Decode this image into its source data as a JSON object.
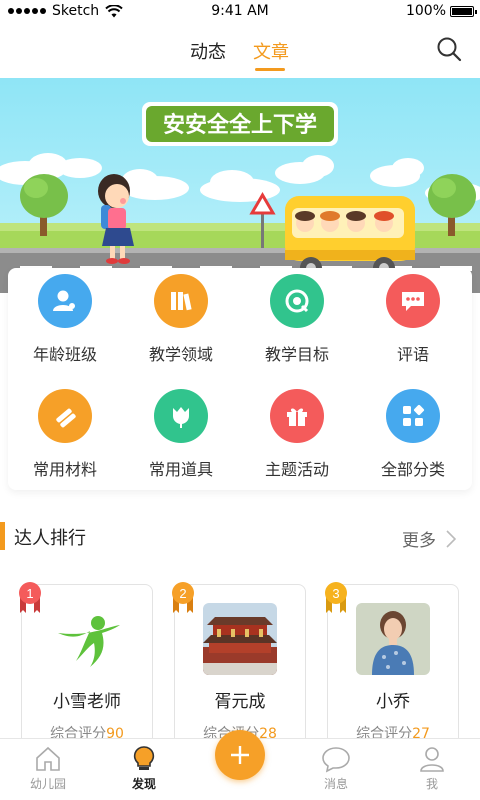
{
  "status_bar": {
    "carrier": "Sketch",
    "time": "9:41 AM",
    "battery": "100%"
  },
  "header": {
    "tabs": [
      {
        "label": "动态"
      },
      {
        "label": "文章"
      }
    ],
    "active_tab": "文章"
  },
  "banner": {
    "title": "安安全全上下学"
  },
  "categories": [
    {
      "label": "年龄班级",
      "icon": "person-icon",
      "color": "#46a9ee"
    },
    {
      "label": "教学领域",
      "icon": "books-icon",
      "color": "#f6a028"
    },
    {
      "label": "教学目标",
      "icon": "target-icon",
      "color": "#31c48d"
    },
    {
      "label": "评语",
      "icon": "comment-icon",
      "color": "#f45b5b"
    },
    {
      "label": "常用材料",
      "icon": "pencil-icon",
      "color": "#f6a028"
    },
    {
      "label": "常用道具",
      "icon": "tulip-icon",
      "color": "#31c48d"
    },
    {
      "label": "主题活动",
      "icon": "gift-icon",
      "color": "#f45b5b"
    },
    {
      "label": "全部分类",
      "icon": "grid-icon",
      "color": "#46a9ee"
    }
  ],
  "ranking": {
    "title": "达人排行",
    "more": "更多",
    "items": [
      {
        "rank": "1",
        "name": "小雪老师",
        "score_label": "综合评分",
        "score": "90",
        "avatar": "green-figure-logo",
        "badge_color": "#f45b5b"
      },
      {
        "rank": "2",
        "name": "胥元成",
        "score_label": "综合评分",
        "score": "28",
        "avatar": "palace-photo",
        "badge_color": "#f6a028"
      },
      {
        "rank": "3",
        "name": "小乔",
        "score_label": "综合评分",
        "score": "27",
        "avatar": "woman-photo",
        "badge_color": "#f6b21e"
      }
    ]
  },
  "bottom_nav": {
    "items": [
      {
        "label": "幼儿园",
        "icon": "house-icon"
      },
      {
        "label": "发现",
        "icon": "lightbulb-icon"
      },
      {
        "label": "消息",
        "icon": "chat-icon"
      },
      {
        "label": "我",
        "icon": "user-icon"
      }
    ],
    "active": "发现",
    "add_icon": "plus-icon"
  },
  "colors": {
    "accent": "#f39a1e"
  }
}
